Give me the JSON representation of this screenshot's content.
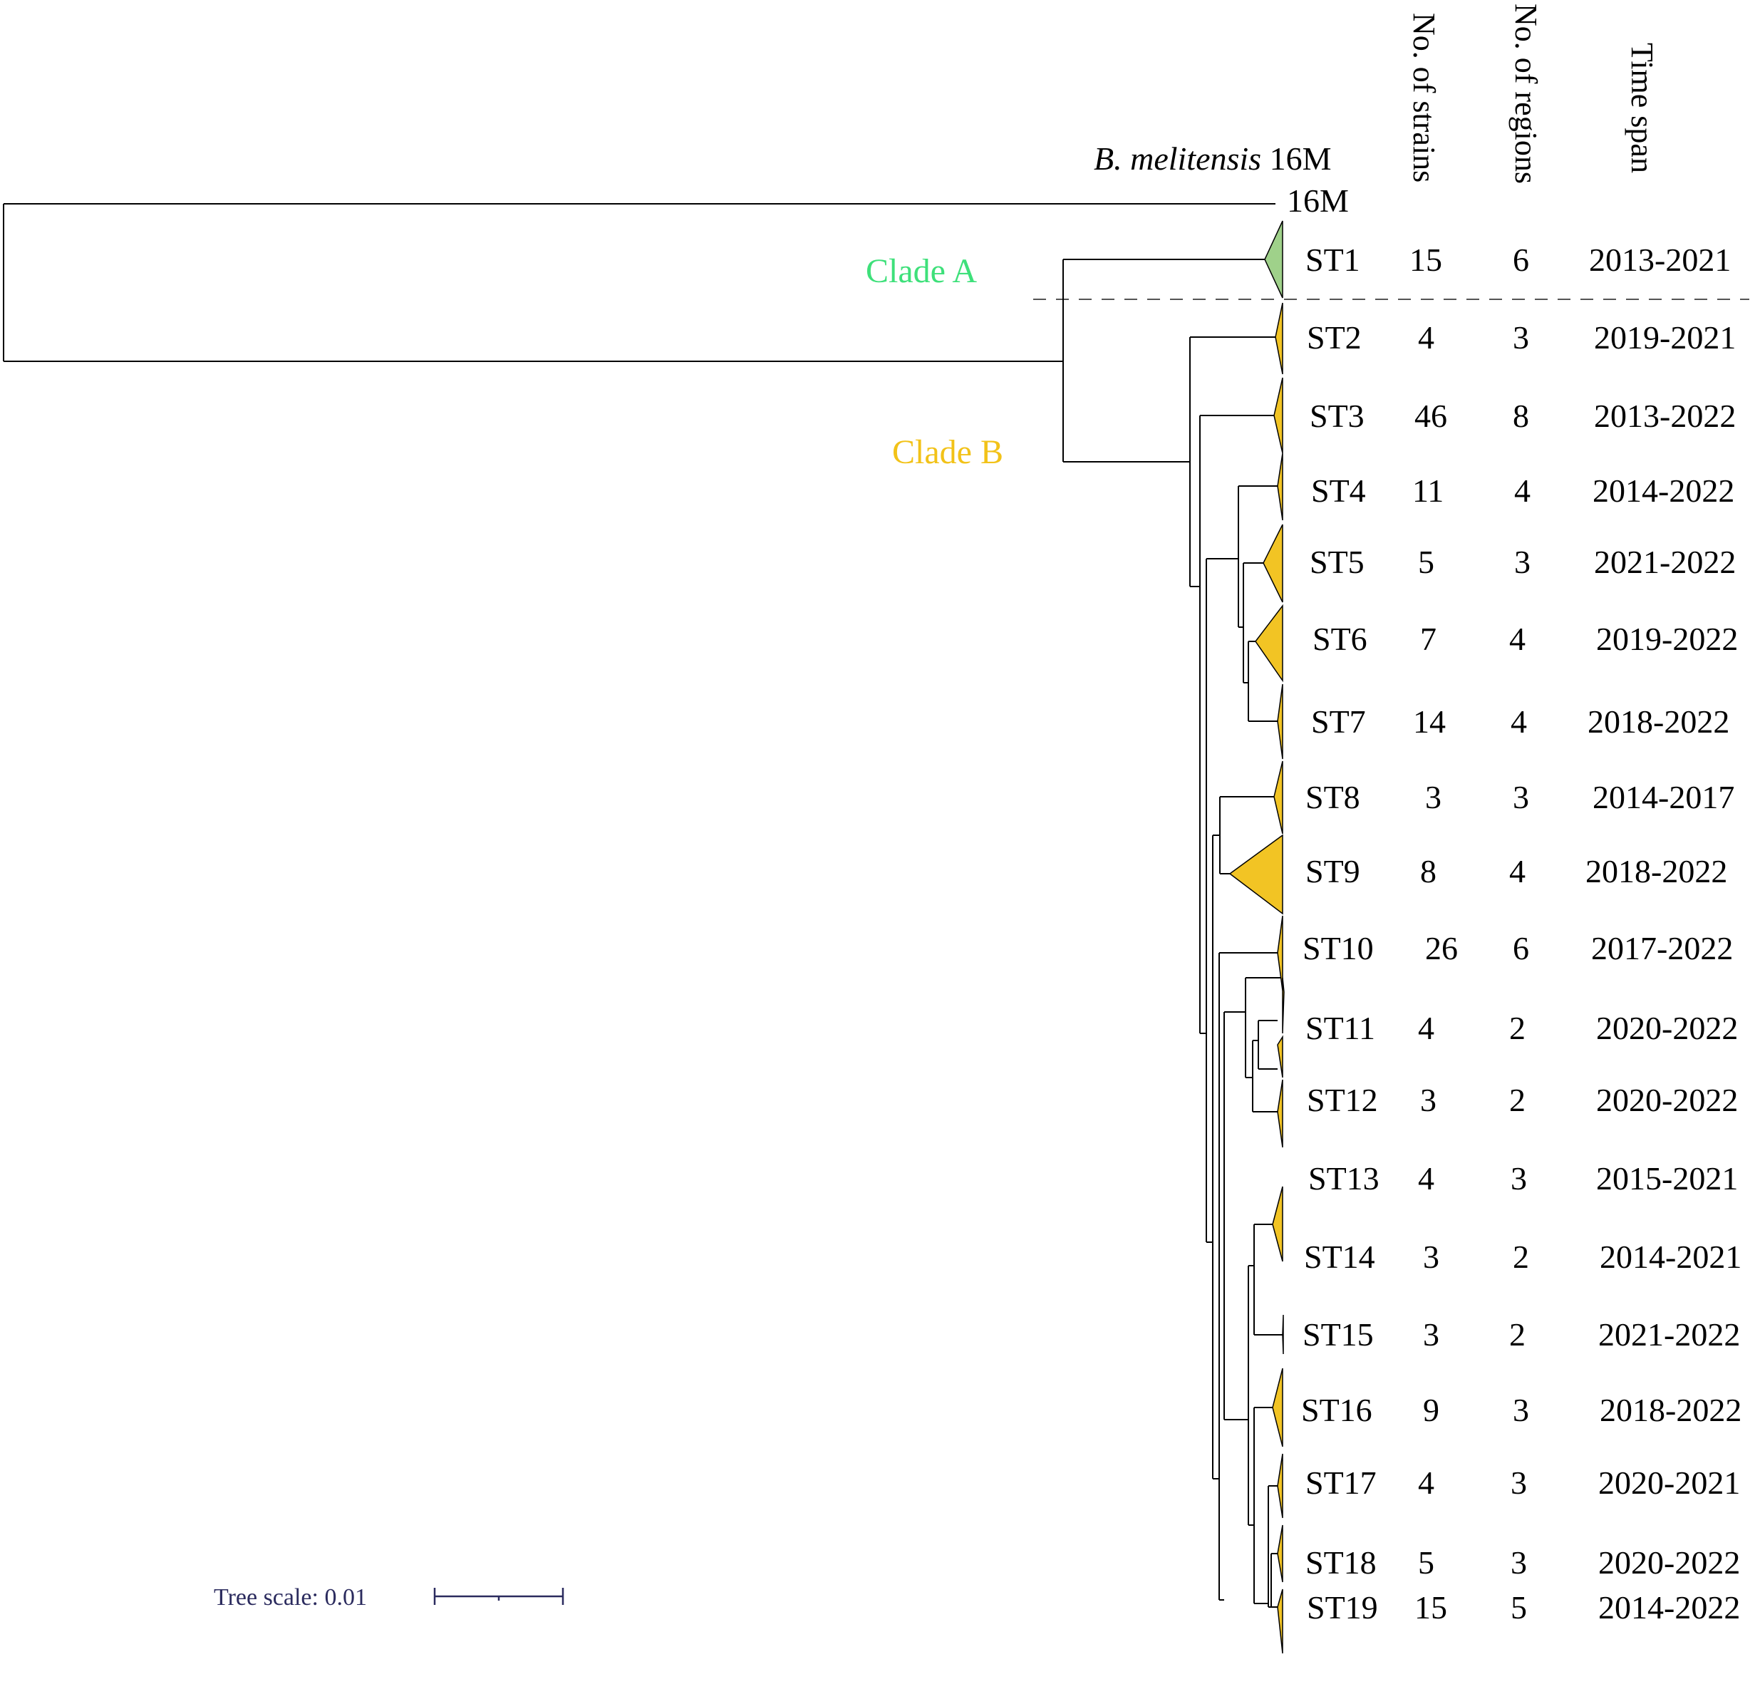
{
  "colors": {
    "clade_a": "#3ee07a",
    "clade_a_fill": "#9fd18a",
    "clade_b": "#f2c218",
    "clade_b_fill": "#f2c424",
    "line": "#000000",
    "scale_text": "#2b2b5e"
  },
  "outgroup": {
    "label_italic": "B. melitensis",
    "label_suffix": " 16M",
    "leaf_label": "16M"
  },
  "clades": {
    "a": "Clade  A",
    "b": "Clade B"
  },
  "headers": {
    "strains": "No. of strains",
    "regions": "No. of regions",
    "span": "Time span"
  },
  "rows": [
    {
      "st": "ST1",
      "strains": "15",
      "regions": "6",
      "span": "2013-2021"
    },
    {
      "st": "ST2",
      "strains": "4",
      "regions": "3",
      "span": "2019-2021"
    },
    {
      "st": "ST3",
      "strains": "46",
      "regions": "8",
      "span": "2013-2022"
    },
    {
      "st": "ST4",
      "strains": "11",
      "regions": "4",
      "span": "2014-2022"
    },
    {
      "st": "ST5",
      "strains": "5",
      "regions": "3",
      "span": "2021-2022"
    },
    {
      "st": "ST6",
      "strains": "7",
      "regions": "4",
      "span": "2019-2022"
    },
    {
      "st": "ST7",
      "strains": "14",
      "regions": "4",
      "span": "2018-2022"
    },
    {
      "st": "ST8",
      "strains": "3",
      "regions": "3",
      "span": "2014-2017"
    },
    {
      "st": "ST9",
      "strains": "8",
      "regions": "4",
      "span": "2018-2022"
    },
    {
      "st": "ST10",
      "strains": "26",
      "regions": "6",
      "span": "2017-2022"
    },
    {
      "st": "ST11",
      "strains": "4",
      "regions": "2",
      "span": "2020-2022"
    },
    {
      "st": "ST12",
      "strains": "3",
      "regions": "2",
      "span": "2020-2022"
    },
    {
      "st": "ST13",
      "strains": "4",
      "regions": "3",
      "span": "2015-2021"
    },
    {
      "st": "ST14",
      "strains": "3",
      "regions": "2",
      "span": "2014-2021"
    },
    {
      "st": "ST15",
      "strains": "3",
      "regions": "2",
      "span": "2021-2022"
    },
    {
      "st": "ST16",
      "strains": "9",
      "regions": "3",
      "span": "2018-2022"
    },
    {
      "st": "ST17",
      "strains": "4",
      "regions": "3",
      "span": "2020-2021"
    },
    {
      "st": "ST18",
      "strains": "5",
      "regions": "3",
      "span": "2020-2022"
    },
    {
      "st": "ST19",
      "strains": "15",
      "regions": "5",
      "span": "2014-2022"
    }
  ],
  "scale": {
    "label": "Tree scale: 0.01",
    "value": 0.01
  }
}
